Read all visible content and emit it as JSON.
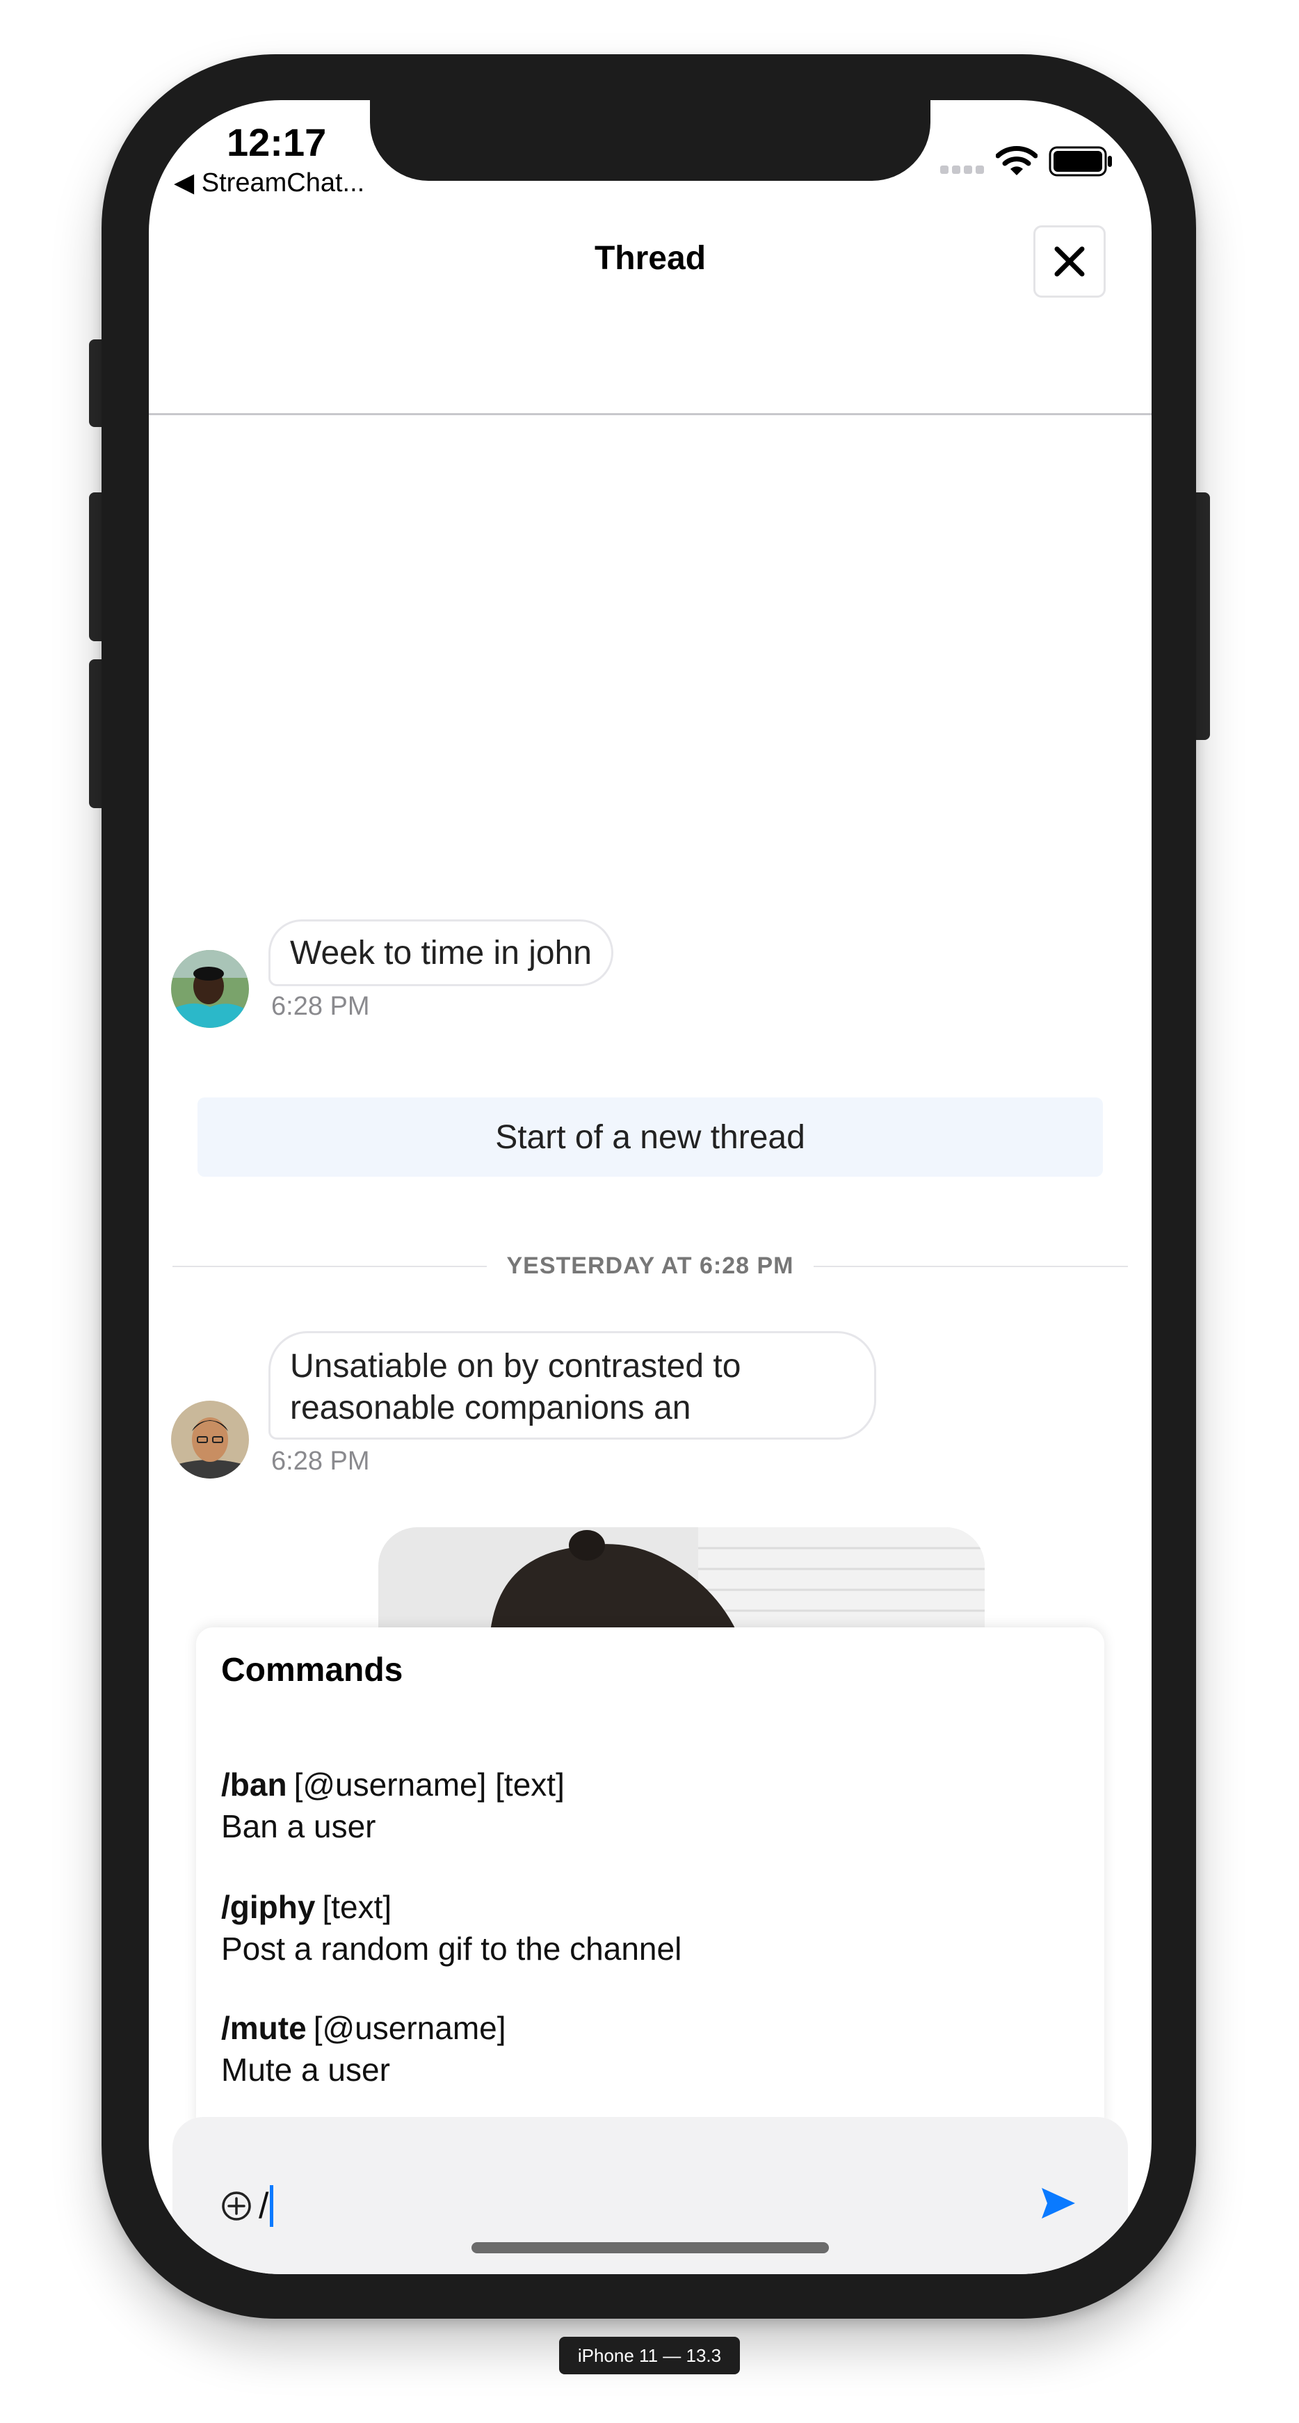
{
  "status_bar": {
    "time": "12:17",
    "back_app": "◀ StreamChat...",
    "signal_icon": "cellular-signal-icon",
    "wifi_icon": "wifi-icon",
    "battery_icon": "battery-full-icon"
  },
  "navbar": {
    "title": "Thread",
    "close_icon": "close-icon"
  },
  "messages": [
    {
      "text": "Week to time in john",
      "time": "6:28 PM"
    },
    {
      "text": "Unsatiable on by contrasted to reasonable companions an",
      "time": "6:28 PM"
    }
  ],
  "thread_banner": "Start of a new thread",
  "date_separator": "YESTERDAY AT 6:28 PM",
  "commands": {
    "title": "Commands",
    "items": [
      {
        "name": "/ban",
        "args": "[@username] [text]",
        "description": "Ban a user"
      },
      {
        "name": "/giphy",
        "args": "[text]",
        "description": "Post a random gif to the channel"
      },
      {
        "name": "/mute",
        "args": "[@username]",
        "description": "Mute a user"
      }
    ]
  },
  "composer": {
    "value": "/",
    "attach_icon": "add-circle-icon",
    "send_icon": "send-icon"
  },
  "device_label": "iPhone 11 — 13.3",
  "colors": {
    "accent": "#0a7aff",
    "banner_bg": "#f1f6fd",
    "composer_bg": "#f2f2f3",
    "frame": "#1c1c1c"
  }
}
